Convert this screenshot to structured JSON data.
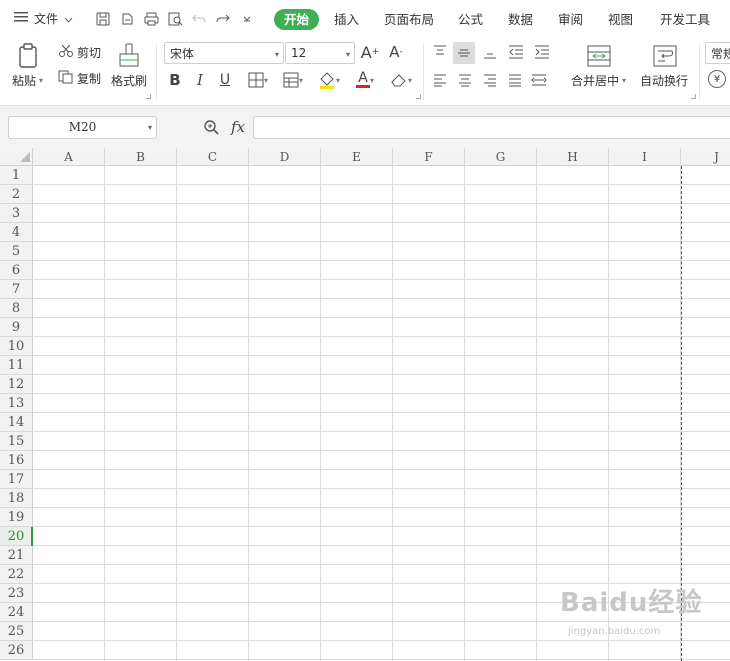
{
  "menu": {
    "file_label": "文件",
    "tabs": [
      "开始",
      "插入",
      "页面布局",
      "公式",
      "数据",
      "审阅",
      "视图",
      "开发工具"
    ],
    "active_tab": "开始"
  },
  "ribbon": {
    "paste_label": "粘贴",
    "cut_label": "剪切",
    "copy_label": "复制",
    "format_painter_label": "格式刷",
    "font_name": "宋体",
    "font_size": "12",
    "merge_label": "合并居中",
    "wrap_label": "自动换行",
    "number_format": "常规",
    "bold_glyph": "B",
    "italic_glyph": "I",
    "underline_glyph": "U",
    "font_color_glyph": "A",
    "grow_glyph": "A",
    "shrink_glyph": "A",
    "currency_glyph": "¥",
    "colors": {
      "accent": "#3fae55",
      "font_color_bar": "#e02020",
      "fill_color_bar": "#f5e400"
    }
  },
  "formula_bar": {
    "name_box": "M20",
    "fx_label": "fx",
    "value": ""
  },
  "sheet": {
    "columns": [
      "A",
      "B",
      "C",
      "D",
      "E",
      "F",
      "G",
      "H",
      "I",
      "J"
    ],
    "rows": [
      "1",
      "2",
      "3",
      "4",
      "5",
      "6",
      "7",
      "8",
      "9",
      "10",
      "11",
      "12",
      "13",
      "14",
      "15",
      "16",
      "17",
      "18",
      "19",
      "20",
      "21",
      "22",
      "23",
      "24",
      "25",
      "26"
    ],
    "active_row": "20"
  },
  "watermark": {
    "brand": "Baidu经验",
    "url": "jingyan.baidu.com"
  }
}
